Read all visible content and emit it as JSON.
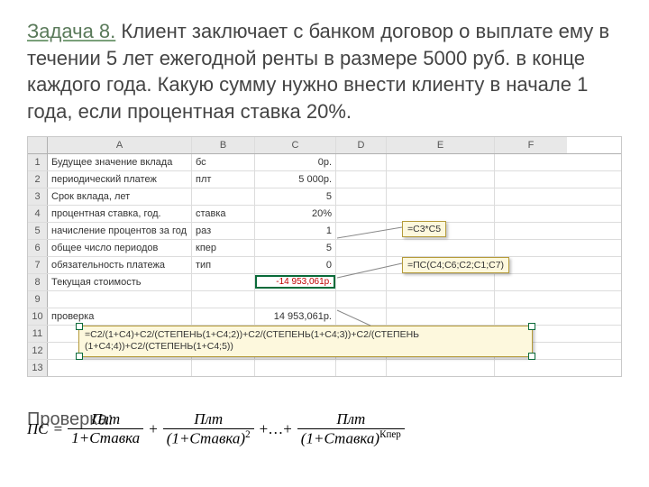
{
  "title_prefix": "Задача 8.",
  "title_body": " Клиент заключает с банком договор о выплате ему в течении 5 лет ежегодной ренты в размере 5000 руб. в конце каждого года. Какую сумму нужно внести клиенту в начале 1 года, если процентная ставка 20%.",
  "columns": [
    "A",
    "B",
    "C",
    "D",
    "E",
    "F"
  ],
  "rows": [
    {
      "n": "1",
      "a": "Будущее значение вклада",
      "b": "бс",
      "c": "0р."
    },
    {
      "n": "2",
      "a": "периодический платеж",
      "b": "плт",
      "c": "5 000р."
    },
    {
      "n": "3",
      "a": "Срок вклада, лет",
      "b": "",
      "c": "5"
    },
    {
      "n": "4",
      "a": "процентная ставка, год.",
      "b": "ставка",
      "c": "20%"
    },
    {
      "n": "5",
      "a": "начисление процентов за год",
      "b": "раз",
      "c": "1"
    },
    {
      "n": "6",
      "a": "общее число периодов",
      "b": "кпер",
      "c": "5"
    },
    {
      "n": "7",
      "a": "обязательность платежа",
      "b": "тип",
      "c": "0"
    },
    {
      "n": "8",
      "a": "Текущая стоимость",
      "b": "",
      "c": "-14 953,061р."
    },
    {
      "n": "9",
      "a": "",
      "b": "",
      "c": ""
    },
    {
      "n": "10",
      "a": "проверка",
      "b": "",
      "c": "14 953,061р."
    },
    {
      "n": "11",
      "a": "",
      "b": "",
      "c": ""
    },
    {
      "n": "12",
      "a": "",
      "b": "",
      "c": ""
    },
    {
      "n": "13",
      "a": "",
      "b": "",
      "c": ""
    }
  ],
  "callout1": "=C3*C5",
  "callout2": "=ПС(C4;C6;C2;C1;C7)",
  "formula_long1": "=C2/(1+C4)+C2/(СТЕПЕНЬ(1+C4;2))+C2/(СТЕПЕНЬ(1+C4;3))+C2/(СТЕПЕНЬ",
  "formula_long2": "(1+C4;4))+C2/(СТЕПЕНЬ(1+C4;5))",
  "check_word": "Проверка:",
  "eq": {
    "lhs": "ПС",
    "eq": "=",
    "plt": "Плт",
    "stavka": "Ставка",
    "one_plus": "1+",
    "lp": "(1+",
    "rp": ")",
    "plus": "+",
    "dots": "+…+",
    "exp2": "2",
    "kper": "Кпер"
  }
}
